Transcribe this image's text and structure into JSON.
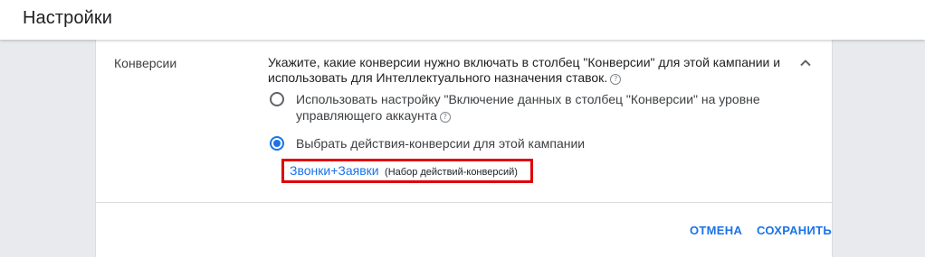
{
  "header": {
    "title": "Настройки"
  },
  "conversions": {
    "label": "Конверсии",
    "description": "Укажите, какие конверсии нужно включать в столбец \"Конверсии\" для этой кампании и использовать для Интеллектуального назначения ставок.",
    "help_icon": "?",
    "options": [
      {
        "label": "Использовать настройку \"Включение данных в столбец \"Конверсии\" на уровне управляющего аккаунта",
        "selected": false
      },
      {
        "label": "Выбрать действия-конверсии для этой кампании",
        "selected": true
      }
    ],
    "conversion_set": {
      "name": "Звонки+Заявки",
      "note": "(Набор действий-конверсий)"
    }
  },
  "actions": {
    "cancel_label": "ОТМЕНА",
    "save_label": "СОХРАНИТЬ"
  },
  "colors": {
    "accent": "#1a73e8",
    "highlight_border": "#e0000a",
    "background": "#e8eaed"
  }
}
